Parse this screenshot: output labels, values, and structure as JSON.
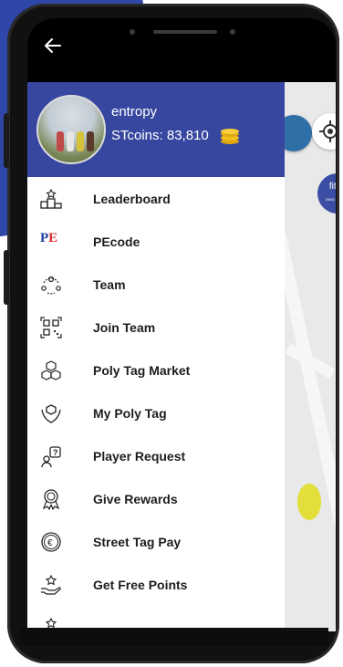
{
  "header": {
    "user_name": "entropy",
    "coins_text": "STcoins: 83,810"
  },
  "map": {
    "fitbit_label": "fitbit",
    "fitbit_sub": "BING POINTS"
  },
  "menu": {
    "items": [
      {
        "label": "Leaderboard",
        "icon": "podium-icon"
      },
      {
        "label": "PEcode",
        "icon": "pe-logo-icon"
      },
      {
        "label": "Team",
        "icon": "team-icon"
      },
      {
        "label": "Join Team",
        "icon": "qr-code-icon"
      },
      {
        "label": "Poly Tag Market",
        "icon": "boxes-icon"
      },
      {
        "label": "My Poly Tag",
        "icon": "hand-box-icon"
      },
      {
        "label": "Player Request",
        "icon": "user-question-icon"
      },
      {
        "label": "Give Rewards",
        "icon": "medal-icon"
      },
      {
        "label": "Street Tag Pay",
        "icon": "euro-coin-icon"
      },
      {
        "label": "Get Free Points",
        "icon": "hand-star-icon"
      }
    ]
  },
  "colors": {
    "header_bg": "#3747a0",
    "accent": "#2f47a8"
  }
}
